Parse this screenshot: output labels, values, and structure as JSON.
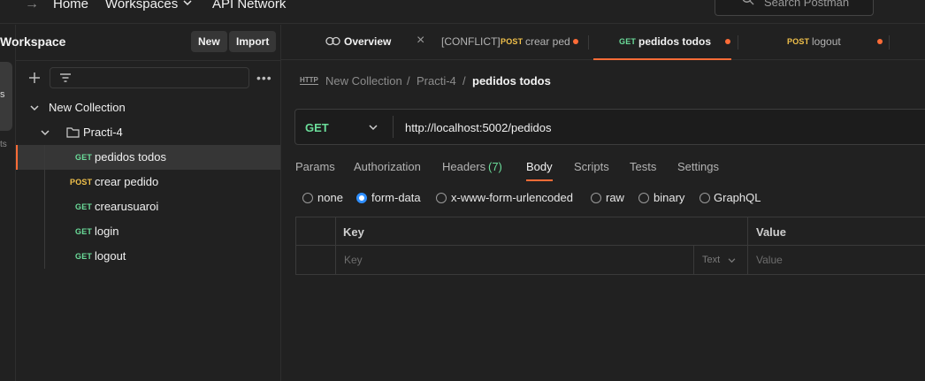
{
  "topnav": {
    "forward_arrow": "→",
    "home": "Home",
    "workspaces": "Workspaces",
    "api_network": "API Network",
    "search_placeholder": "Search Postman"
  },
  "rail": {
    "item_partial": "s",
    "item2_partial": "ts"
  },
  "sidebar": {
    "workspace_title": "Workspace",
    "new_label": "New",
    "import_label": "Import",
    "more_label": "•••",
    "tree": {
      "collection": "New Collection",
      "folder": "Practi-4",
      "requests": [
        {
          "method": "GET",
          "name": "pedidos todos"
        },
        {
          "method": "POST",
          "name": "crear pedido"
        },
        {
          "method": "GET",
          "name": "crearusuaroi"
        },
        {
          "method": "GET",
          "name": "login"
        },
        {
          "method": "GET",
          "name": "logout"
        }
      ]
    }
  },
  "tabs": [
    {
      "label": "Overview"
    },
    {
      "prefix": "[CONFLICT]",
      "method": "POST",
      "label": "crear ped"
    },
    {
      "method": "GET",
      "label": "pedidos todos"
    },
    {
      "method": "POST",
      "label": "logout"
    }
  ],
  "tab_close": "×",
  "breadcrumb": {
    "badge": "HTTP",
    "collection": "New Collection",
    "sep": "/",
    "folder": "Practi-4",
    "request": "pedidos todos"
  },
  "request": {
    "method": "GET",
    "url": "http://localhost:5002/pedidos"
  },
  "request_tabs": {
    "params": "Params",
    "authorization": "Authorization",
    "headers": "Headers",
    "headers_count": "(7)",
    "body": "Body",
    "scripts": "Scripts",
    "tests": "Tests",
    "settings": "Settings"
  },
  "body_types": {
    "none": "none",
    "form_data": "form-data",
    "urlencoded": "x-www-form-urlencoded",
    "raw": "raw",
    "binary": "binary",
    "graphql": "GraphQL",
    "selected": "form-data"
  },
  "table": {
    "key_header": "Key",
    "value_header": "Value",
    "key_placeholder": "Key",
    "type": "Text",
    "value_placeholder": "Value"
  },
  "colors": {
    "accent": "#ff6c37",
    "get": "#6bdd9a",
    "post": "#f1c14b",
    "radio_on": "#2f8fff"
  }
}
